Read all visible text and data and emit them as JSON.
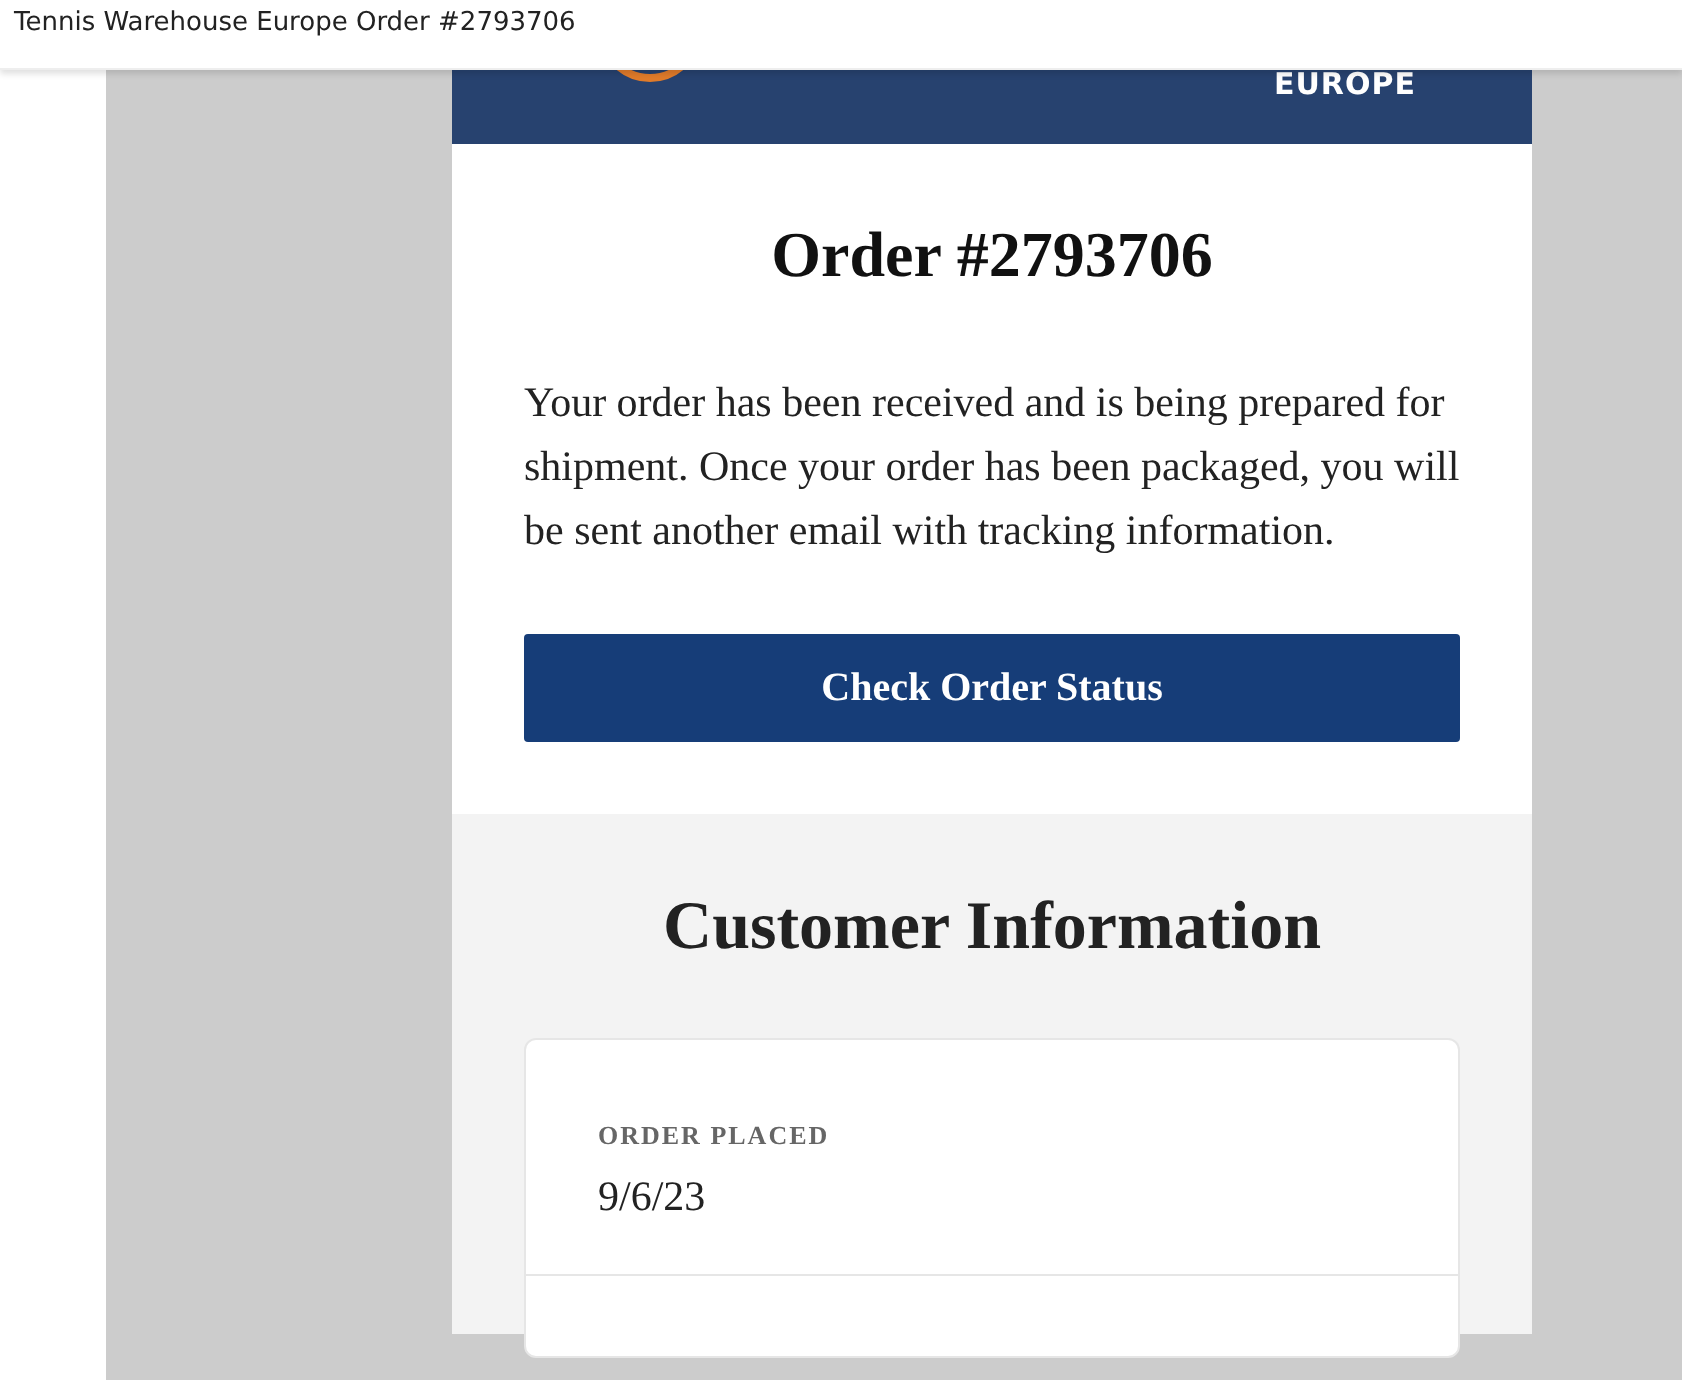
{
  "window": {
    "title": "Tennis Warehouse Europe Order #2793706"
  },
  "header": {
    "brand_text": "EUROPE"
  },
  "order": {
    "heading": "Order #2793706",
    "message": "Your order has been received and is being prepared for shipment. Once your order has been packaged, you will be sent another email with tracking information.",
    "button": "Check Order Status"
  },
  "customer_information": {
    "heading": "Customer Information",
    "fields": [
      {
        "label": "ORDER PLACED",
        "value": "9/6/23"
      }
    ]
  }
}
